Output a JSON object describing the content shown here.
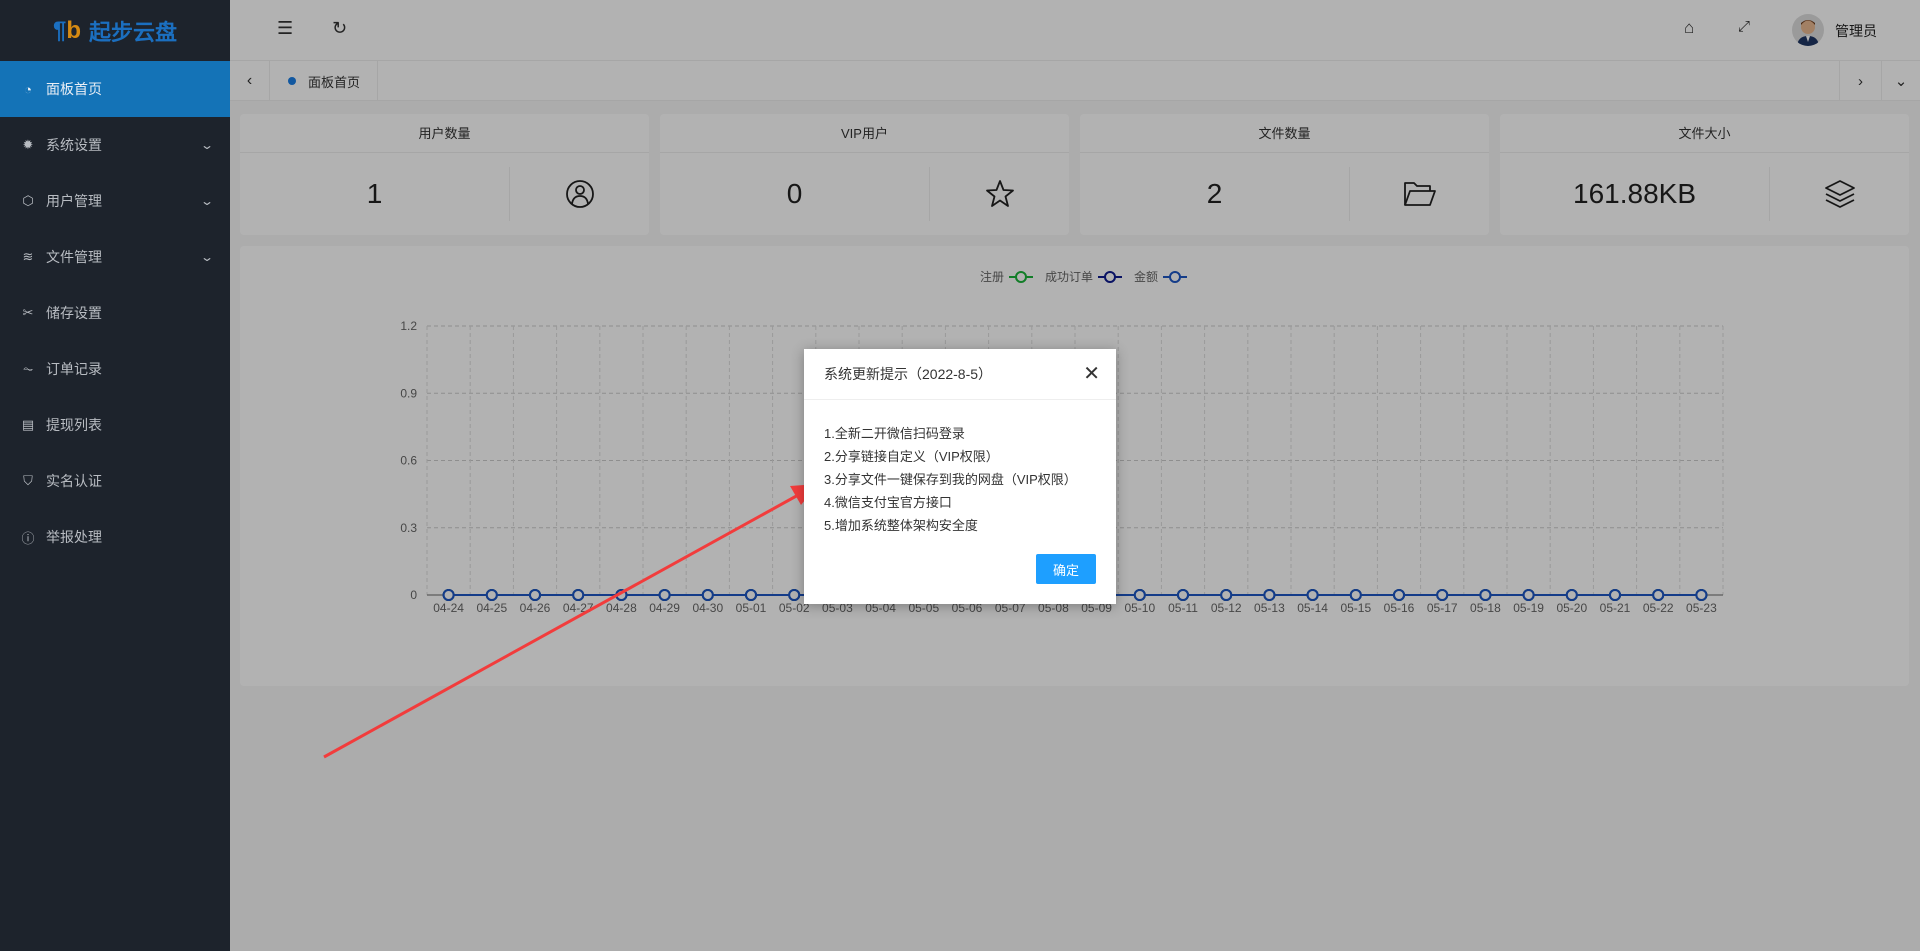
{
  "brand": {
    "name": "起步云盘",
    "mark_a": "ql",
    "mark_b": "b"
  },
  "sidebar": {
    "items": [
      {
        "label": "面板首页",
        "icon": "dashboard-icon",
        "active": true
      },
      {
        "label": "系统设置",
        "icon": "gear-icon",
        "expand": true
      },
      {
        "label": "用户管理",
        "icon": "cube-icon",
        "expand": true
      },
      {
        "label": "文件管理",
        "icon": "layers-icon",
        "expand": true
      },
      {
        "label": "储存设置",
        "icon": "tools-icon"
      },
      {
        "label": "订单记录",
        "icon": "pulse-icon"
      },
      {
        "label": "提现列表",
        "icon": "clipboard-icon"
      },
      {
        "label": "实名认证",
        "icon": "shield-check-icon"
      },
      {
        "label": "举报处理",
        "icon": "info-icon"
      }
    ]
  },
  "header": {
    "user_name": "管理员"
  },
  "tabs": {
    "active": "面板首页"
  },
  "stats": [
    {
      "title": "用户数量",
      "value": "1",
      "icon": "user-circle-icon"
    },
    {
      "title": "VIP用户",
      "value": "0",
      "icon": "star-icon"
    },
    {
      "title": "文件数量",
      "value": "2",
      "icon": "folder-open-icon"
    },
    {
      "title": "文件大小",
      "value": "161.88KB",
      "icon": "layers-icon"
    }
  ],
  "chart_data": {
    "type": "line",
    "legend": [
      "注册",
      "成功订单",
      "金额"
    ],
    "legend_placement": "top-center",
    "colors": [
      "#1bb43a",
      "#0d1a8f",
      "#1d56c4"
    ],
    "categories": [
      "04-24",
      "04-25",
      "04-26",
      "04-27",
      "04-28",
      "04-29",
      "04-30",
      "05-01",
      "05-02",
      "05-03",
      "05-04",
      "05-05",
      "05-06",
      "05-07",
      "05-08",
      "05-09",
      "05-10",
      "05-11",
      "05-12",
      "05-13",
      "05-14",
      "05-15",
      "05-16",
      "05-17",
      "05-18",
      "05-19",
      "05-20",
      "05-21",
      "05-22",
      "05-23"
    ],
    "series": [
      {
        "name": "注册",
        "values": [
          0,
          0,
          0,
          0,
          0,
          0,
          0,
          0,
          0,
          0,
          0,
          0,
          0,
          0,
          0,
          0,
          0,
          0,
          0,
          0,
          0,
          0,
          0,
          0,
          0,
          0,
          0,
          0,
          0,
          0
        ]
      },
      {
        "name": "成功订单",
        "values": [
          0,
          0,
          0,
          0,
          0,
          0,
          0,
          0,
          0,
          0,
          0,
          0,
          0,
          0,
          0,
          0,
          0,
          0,
          0,
          0,
          0,
          0,
          0,
          0,
          0,
          0,
          0,
          0,
          0,
          0
        ]
      },
      {
        "name": "金额",
        "values": [
          0,
          0,
          0,
          0,
          0,
          0,
          0,
          0,
          0,
          0,
          0,
          0,
          0,
          0,
          0,
          0,
          0,
          0,
          0,
          0,
          0,
          0,
          0,
          0,
          0,
          0,
          0,
          0,
          0,
          0
        ]
      }
    ],
    "yticks": [
      "0",
      "0.3",
      "0.6",
      "0.9",
      "1.2"
    ],
    "ylim": [
      0,
      1.2
    ],
    "grid": true
  },
  "dialog": {
    "title": "系统更新提示（2022-8-5）",
    "lines": [
      "1.全新二开微信扫码登录",
      "2.分享链接自定义（VIP权限）",
      "3.分享文件一键保存到我的网盘（VIP权限）",
      "4.微信支付宝官方接口",
      "5.增加系统整体架构安全度"
    ],
    "confirm": "确定"
  }
}
